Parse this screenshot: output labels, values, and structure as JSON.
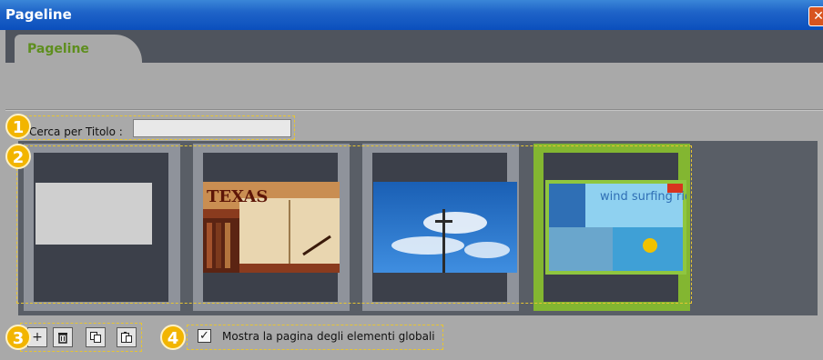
{
  "window": {
    "title": "Pageline",
    "close_glyph": "✕"
  },
  "tabs": [
    {
      "label": "Pageline"
    }
  ],
  "search": {
    "label": "Cerca per Titolo :",
    "value": ""
  },
  "pages": [
    {
      "name": "page-1",
      "thumbnail": "blank"
    },
    {
      "name": "page-2",
      "thumbnail": "texas-book",
      "text": "TEXAS"
    },
    {
      "name": "page-3",
      "thumbnail": "sky-cross"
    },
    {
      "name": "page-4",
      "thumbnail": "windsurf-ad",
      "selected": true,
      "text": "wind surfing riders"
    }
  ],
  "toolbar": {
    "buttons": [
      {
        "name": "add-page-button",
        "glyph": "+"
      },
      {
        "name": "delete-page-button",
        "glyph": "🗑"
      },
      {
        "name": "copy-page-button",
        "glyph": "⧉"
      },
      {
        "name": "paste-page-button",
        "glyph": "📋"
      }
    ]
  },
  "global_elements": {
    "label": "Mostra la pagina degli elementi globali",
    "checked": true,
    "check_glyph": "✓"
  },
  "annotations": [
    "1",
    "2",
    "3",
    "4"
  ],
  "colors": {
    "accent_green": "#83b631",
    "tab_text": "#5e8e1e",
    "callout": "#f2b500"
  }
}
